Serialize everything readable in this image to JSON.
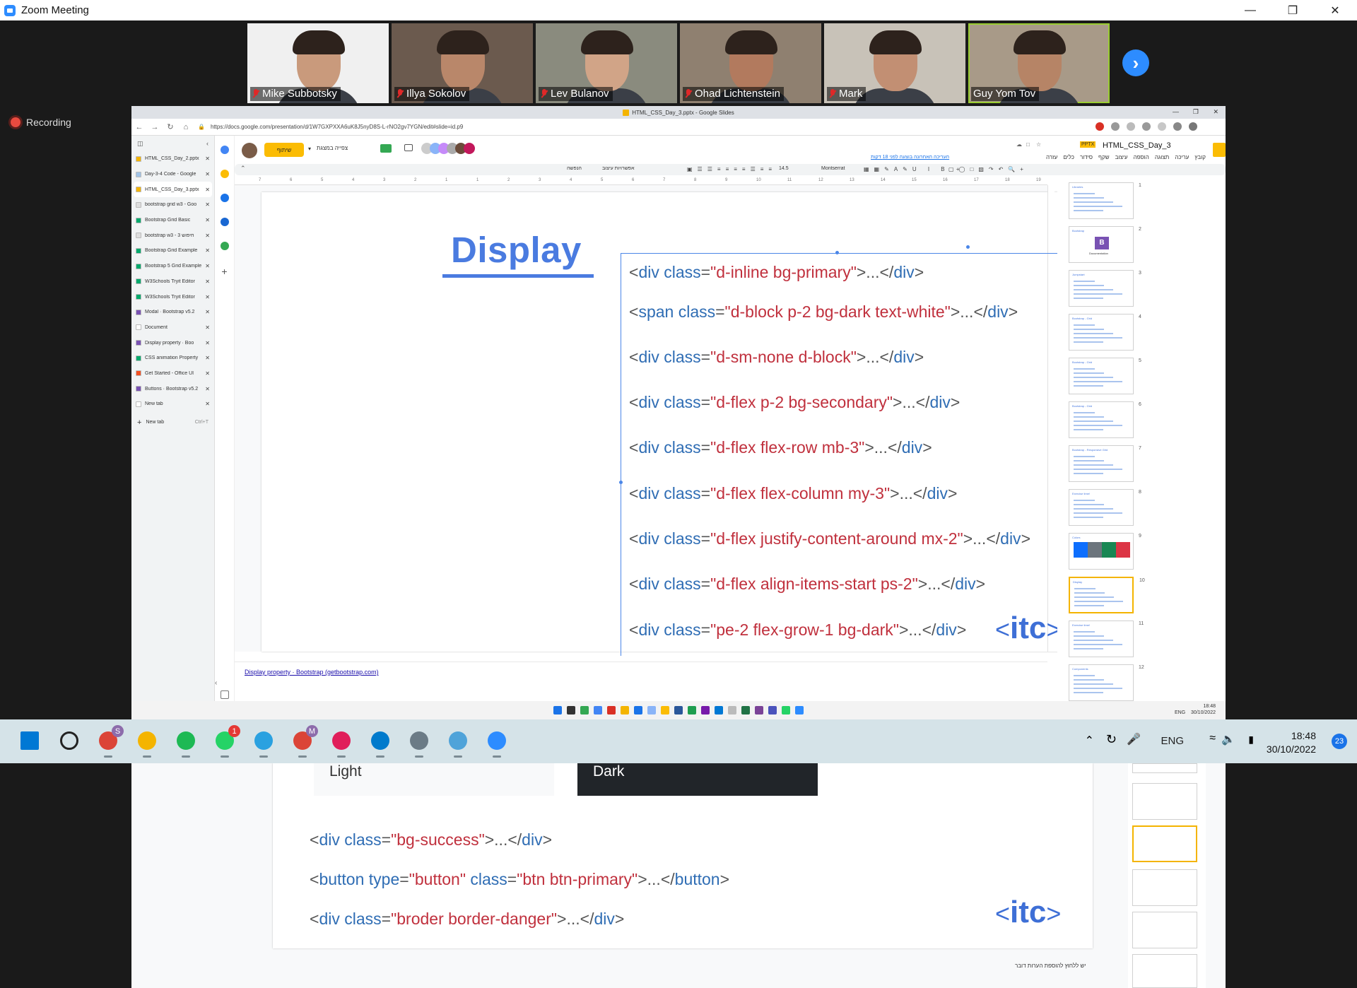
{
  "window": {
    "title": "Zoom Meeting"
  },
  "gallery": {
    "participants": [
      {
        "name": "Mike Subbotsky",
        "muted": true
      },
      {
        "name": "Illya Sokolov",
        "muted": true
      },
      {
        "name": "Lev Bulanov",
        "muted": true
      },
      {
        "name": "Ohad Lichtenstein",
        "muted": true
      },
      {
        "name": "Mark",
        "muted": true
      },
      {
        "name": "Guy Yom Tov",
        "muted": false
      }
    ]
  },
  "recording": {
    "label": "Recording"
  },
  "chrome": {
    "window_title": "HTML_CSS_Day_3.pptx - Google Slides",
    "url": "https://docs.google.com/presentation/d/1W7GXPXXA6uK8J5nyD8S-L-rNO2gv7YGN/edit#slide=id.p9",
    "tabs": [
      {
        "label": "HTML_CSS_Day_2.pptx",
        "color": "#f4b400"
      },
      {
        "label": "Day-3-4 Code - Google",
        "color": "#a0c4e8"
      },
      {
        "label": "HTML_CSS_Day_3.pptx",
        "color": "#f4b400",
        "selected": true
      },
      {
        "label": "bootstrap grid w3 - Goo",
        "color": "#dddddd"
      },
      {
        "label": "Bootstrap Grid Basic",
        "color": "#04aa6d"
      },
      {
        "label": "bootstrap w3 - 3 חיפוש",
        "color": "#dddddd"
      },
      {
        "label": "Bootstrap Grid Example",
        "color": "#04aa6d"
      },
      {
        "label": "Bootstrap 5 Grid Example",
        "color": "#04aa6d"
      },
      {
        "label": "W3Schools Tryit Editor",
        "color": "#04aa6d"
      },
      {
        "label": "W3Schools Tryit Editor",
        "color": "#04aa6d"
      },
      {
        "label": "Modal · Bootstrap v5.2",
        "color": "#7952b3"
      },
      {
        "label": "Document",
        "color": "#ffffff"
      },
      {
        "label": "Display property · Boo",
        "color": "#7952b3"
      },
      {
        "label": "CSS animation Property",
        "color": "#04aa6d"
      },
      {
        "label": "Get Started - Office UI",
        "color": "#f25022"
      },
      {
        "label": "Buttons · Bootstrap v5.2",
        "color": "#7952b3"
      },
      {
        "label": "New tab",
        "color": "#ffffff",
        "hovered": true
      }
    ],
    "new_tab": {
      "label": "New tab",
      "shortcut": "Ctrl+T"
    }
  },
  "slides": {
    "doc_title": "HTML_CSS_Day_3",
    "doc_badge": "PPTX",
    "share_label": "שיתוף",
    "present_label": "צפייה במצגת",
    "last_edit": "העריכה האחרונה בוצעה לפני 18 דקות",
    "menus": [
      "קובץ",
      "עריכה",
      "תצוגה",
      "הוספה",
      "עיצוב",
      "שקף",
      "סידור",
      "כלים",
      "עזרה"
    ],
    "font": "Montserrat",
    "font_size": "14.5",
    "format_options": "אפשרויות עיצוב",
    "animate": "הנפשה",
    "ruler_marks": [
      "7",
      "6",
      "5",
      "4",
      "3",
      "2",
      "1",
      "1",
      "2",
      "3",
      "4",
      "5",
      "6",
      "7",
      "8",
      "9",
      "10",
      "11",
      "12",
      "13",
      "14",
      "15",
      "16",
      "17",
      "18",
      "19"
    ],
    "current_slide": {
      "title": "Display",
      "lines": [
        {
          "open": "<",
          "tag": "div",
          "attr": "class",
          "value": "\"d-inline  bg-primary\"",
          "close": ">...</",
          "etag": "div",
          "end": ">"
        },
        {
          "open": "<",
          "tag": "span",
          "attr": "class",
          "value": "\"d-block p-2 bg-dark text-white\"",
          "close": ">...</",
          "etag": "div",
          "end": ">"
        },
        {
          "open": "<",
          "tag": "div",
          "attr": "class",
          "value": "\"d-sm-none d-block\"",
          "close": ">...</",
          "etag": "div",
          "end": ">"
        },
        {
          "open": "<",
          "tag": "div",
          "attr": "class",
          "value": "\"d-flex p-2 bg-secondary\"",
          "close": ">...</",
          "etag": "div",
          "end": ">"
        },
        {
          "open": "<",
          "tag": "div",
          "attr": "class",
          "value": "\"d-flex flex-row mb-3\"",
          "close": ">...</",
          "etag": "div",
          "end": ">"
        },
        {
          "open": "<",
          "tag": "div",
          "attr": "class",
          "value": "\"d-flex flex-column my-3\"",
          "close": ">...</",
          "etag": "div",
          "end": ">"
        },
        {
          "open": "<",
          "tag": "div",
          "attr": "class",
          "value": "\"d-flex justify-content-around mx-2\"",
          "close": ">...</",
          "etag": "div",
          "end": ">"
        },
        {
          "open": "<",
          "tag": "div",
          "attr": "class",
          "value": "\"d-flex align-items-start ps-2\"",
          "close": ">...</",
          "etag": "div",
          "end": ">"
        },
        {
          "open": "<",
          "tag": "div",
          "attr": "class",
          "value": "\"pe-2 flex-grow-1 bg-dark\"",
          "close": ">...</",
          "etag": "div",
          "end": ">"
        }
      ],
      "logo": {
        "left": "<",
        "text": "itc",
        "right": ">"
      }
    },
    "speaker_note": "Display property · Bootstrap (getbootstrap.com)",
    "thumb_numbers": [
      "1",
      "2",
      "3",
      "4",
      "5",
      "6",
      "7",
      "8",
      "9",
      "10",
      "11",
      "12"
    ],
    "thumb_titles": [
      "Libraries",
      "Bootstrap",
      "Jumpstart",
      "Bootstrap - Grid",
      "Bootstrap - Grid",
      "Bootstrap - Grid",
      "Bootstrap - Responsive Grid",
      "Exercise time!",
      "Colors",
      "Display",
      "Exercise time!",
      "Components"
    ],
    "bootstrap_logo": "B",
    "bootstrap_caption": "Documentation"
  },
  "inner_taskbar": {
    "lang": "ENG",
    "time": "18:48",
    "date": "30/10/2022"
  },
  "bottom_slide": {
    "swatches": [
      {
        "label": "Light"
      },
      {
        "label": "Dark"
      }
    ],
    "lines": [
      {
        "open": "<",
        "tag": "div",
        "attr": "class",
        "value": "\"bg-success\"",
        "close": ">...</",
        "etag": "div",
        "end": ">"
      },
      {
        "open": "<",
        "tag": "button",
        "attr": "type",
        "value": "\"button\"",
        "attr2": "class",
        "value2": "\"btn btn-primary\"",
        "close": ">...</",
        "etag": "button",
        "end": ">"
      },
      {
        "open": "<",
        "tag": "div",
        "attr": "class",
        "value": "\"broder border-danger\"",
        "close": ">...</",
        "etag": "div",
        "end": ">"
      }
    ],
    "logo": {
      "left": "<",
      "text": "itc",
      "right": ">"
    },
    "speaker_hint": "יש ללחוץ להוספת הערות דובר"
  },
  "taskbar": {
    "apps": [
      {
        "name": "windows-start-icon"
      },
      {
        "name": "search-icon"
      },
      {
        "name": "chrome-icon",
        "badge": "S"
      },
      {
        "name": "file-explorer-icon"
      },
      {
        "name": "spotify-icon"
      },
      {
        "name": "whatsapp-icon",
        "badge": "1"
      },
      {
        "name": "telegram-icon"
      },
      {
        "name": "chrome-profile-icon",
        "badge": "M"
      },
      {
        "name": "slack-icon"
      },
      {
        "name": "vscode-icon"
      },
      {
        "name": "settings-icon"
      },
      {
        "name": "paint-icon"
      },
      {
        "name": "zoom-icon"
      }
    ],
    "lang": "ENG",
    "time": "18:48",
    "date": "30/10/2022",
    "notifications": "23"
  },
  "colors": {
    "accent": "#2d8cff",
    "slide_title": "#4a7be0",
    "code_tag": "#2f6db4",
    "code_value": "#c0303d"
  }
}
